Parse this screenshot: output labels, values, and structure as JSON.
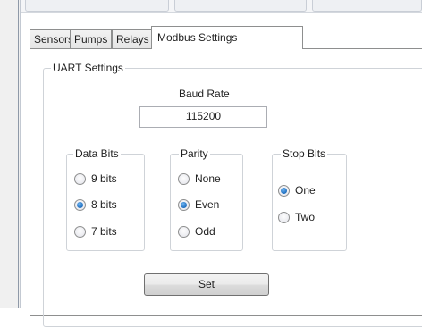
{
  "tabs": [
    {
      "label": "Sensors"
    },
    {
      "label": "Pumps"
    },
    {
      "label": "Relays"
    },
    {
      "label": "Modbus Settings"
    }
  ],
  "uart": {
    "group_title": "UART Settings",
    "baud_rate_label": "Baud Rate",
    "baud_rate_value": "115200",
    "data_bits": {
      "title": "Data Bits",
      "options": [
        "9 bits",
        "8 bits",
        "7 bits"
      ],
      "selected": "8 bits"
    },
    "parity": {
      "title": "Parity",
      "options": [
        "None",
        "Even",
        "Odd"
      ],
      "selected": "Even"
    },
    "stop_bits": {
      "title": "Stop Bits",
      "options": [
        "One",
        "Two"
      ],
      "selected": "One"
    },
    "set_button_label": "Set"
  }
}
